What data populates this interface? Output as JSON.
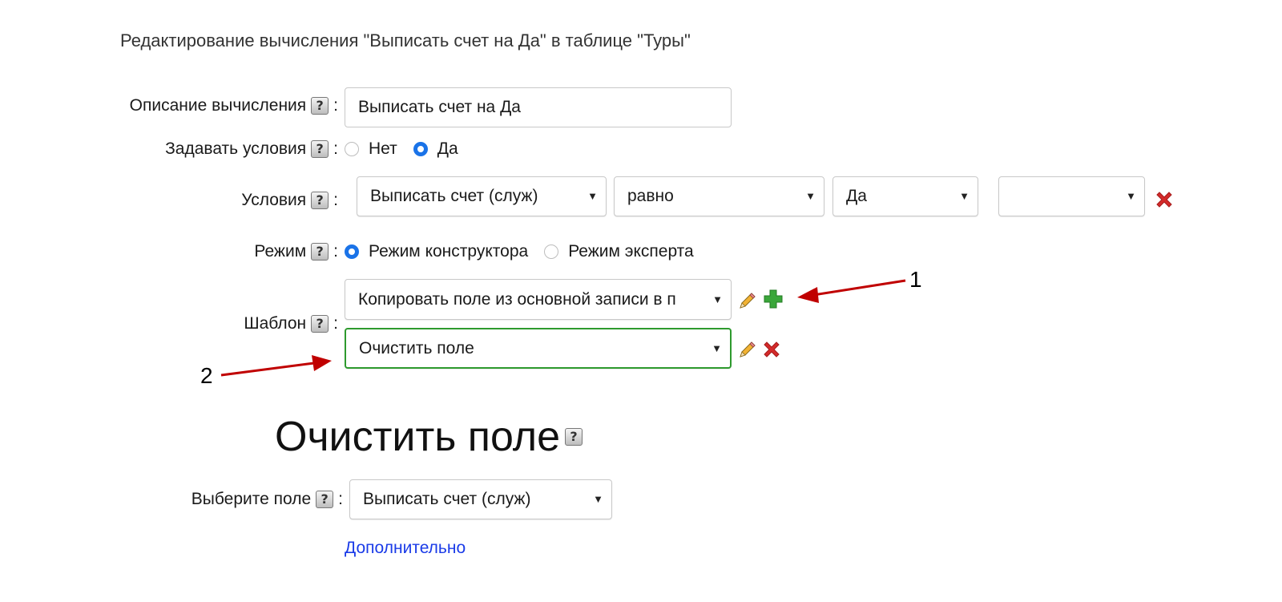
{
  "page_title": "Редактирование вычисления \"Выписать счет на Да\" в таблице \"Туры\"",
  "help_icon_glyph": "?",
  "colon": ":",
  "description": {
    "label": "Описание вычисления",
    "value": "Выписать счет на Да"
  },
  "set_conditions": {
    "label": "Задавать условия",
    "options": [
      "Нет",
      "Да"
    ],
    "selected": "Да"
  },
  "conditions": {
    "label": "Условия",
    "field": "Выписать счет (служ)",
    "operator": "равно",
    "value": "Да",
    "extra": ""
  },
  "mode": {
    "label": "Режим",
    "options": [
      "Режим конструктора",
      "Режим эксперта"
    ],
    "selected": "Режим конструктора"
  },
  "template": {
    "label": "Шаблон",
    "items": [
      "Копировать поле из основной записи в п",
      "Очистить поле"
    ]
  },
  "section": {
    "title": "Очистить поле",
    "select_field_label": "Выберите поле",
    "select_field_value": "Выписать счет (служ)",
    "more_link": "Дополнительно"
  },
  "annotations": [
    "1",
    "2"
  ],
  "colors": {
    "accent_blue": "#1a73e8",
    "active_green": "#2e9a2e",
    "annotation_red": "#c00000",
    "link_blue": "#1a3be8",
    "delete_red": "#d42a2a",
    "add_green": "#3aa63a"
  }
}
